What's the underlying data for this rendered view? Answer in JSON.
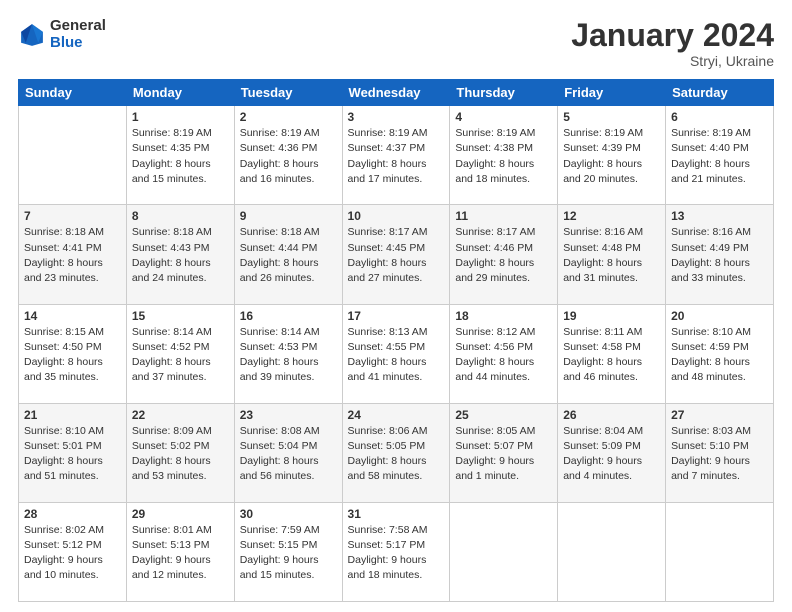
{
  "header": {
    "logo_line1": "General",
    "logo_line2": "Blue",
    "month_title": "January 2024",
    "location": "Stryi, Ukraine"
  },
  "weekdays": [
    "Sunday",
    "Monday",
    "Tuesday",
    "Wednesday",
    "Thursday",
    "Friday",
    "Saturday"
  ],
  "weeks": [
    [
      {
        "day": "",
        "info": ""
      },
      {
        "day": "1",
        "info": "Sunrise: 8:19 AM\nSunset: 4:35 PM\nDaylight: 8 hours\nand 15 minutes."
      },
      {
        "day": "2",
        "info": "Sunrise: 8:19 AM\nSunset: 4:36 PM\nDaylight: 8 hours\nand 16 minutes."
      },
      {
        "day": "3",
        "info": "Sunrise: 8:19 AM\nSunset: 4:37 PM\nDaylight: 8 hours\nand 17 minutes."
      },
      {
        "day": "4",
        "info": "Sunrise: 8:19 AM\nSunset: 4:38 PM\nDaylight: 8 hours\nand 18 minutes."
      },
      {
        "day": "5",
        "info": "Sunrise: 8:19 AM\nSunset: 4:39 PM\nDaylight: 8 hours\nand 20 minutes."
      },
      {
        "day": "6",
        "info": "Sunrise: 8:19 AM\nSunset: 4:40 PM\nDaylight: 8 hours\nand 21 minutes."
      }
    ],
    [
      {
        "day": "7",
        "info": "Sunrise: 8:18 AM\nSunset: 4:41 PM\nDaylight: 8 hours\nand 23 minutes."
      },
      {
        "day": "8",
        "info": "Sunrise: 8:18 AM\nSunset: 4:43 PM\nDaylight: 8 hours\nand 24 minutes."
      },
      {
        "day": "9",
        "info": "Sunrise: 8:18 AM\nSunset: 4:44 PM\nDaylight: 8 hours\nand 26 minutes."
      },
      {
        "day": "10",
        "info": "Sunrise: 8:17 AM\nSunset: 4:45 PM\nDaylight: 8 hours\nand 27 minutes."
      },
      {
        "day": "11",
        "info": "Sunrise: 8:17 AM\nSunset: 4:46 PM\nDaylight: 8 hours\nand 29 minutes."
      },
      {
        "day": "12",
        "info": "Sunrise: 8:16 AM\nSunset: 4:48 PM\nDaylight: 8 hours\nand 31 minutes."
      },
      {
        "day": "13",
        "info": "Sunrise: 8:16 AM\nSunset: 4:49 PM\nDaylight: 8 hours\nand 33 minutes."
      }
    ],
    [
      {
        "day": "14",
        "info": "Sunrise: 8:15 AM\nSunset: 4:50 PM\nDaylight: 8 hours\nand 35 minutes."
      },
      {
        "day": "15",
        "info": "Sunrise: 8:14 AM\nSunset: 4:52 PM\nDaylight: 8 hours\nand 37 minutes."
      },
      {
        "day": "16",
        "info": "Sunrise: 8:14 AM\nSunset: 4:53 PM\nDaylight: 8 hours\nand 39 minutes."
      },
      {
        "day": "17",
        "info": "Sunrise: 8:13 AM\nSunset: 4:55 PM\nDaylight: 8 hours\nand 41 minutes."
      },
      {
        "day": "18",
        "info": "Sunrise: 8:12 AM\nSunset: 4:56 PM\nDaylight: 8 hours\nand 44 minutes."
      },
      {
        "day": "19",
        "info": "Sunrise: 8:11 AM\nSunset: 4:58 PM\nDaylight: 8 hours\nand 46 minutes."
      },
      {
        "day": "20",
        "info": "Sunrise: 8:10 AM\nSunset: 4:59 PM\nDaylight: 8 hours\nand 48 minutes."
      }
    ],
    [
      {
        "day": "21",
        "info": "Sunrise: 8:10 AM\nSunset: 5:01 PM\nDaylight: 8 hours\nand 51 minutes."
      },
      {
        "day": "22",
        "info": "Sunrise: 8:09 AM\nSunset: 5:02 PM\nDaylight: 8 hours\nand 53 minutes."
      },
      {
        "day": "23",
        "info": "Sunrise: 8:08 AM\nSunset: 5:04 PM\nDaylight: 8 hours\nand 56 minutes."
      },
      {
        "day": "24",
        "info": "Sunrise: 8:06 AM\nSunset: 5:05 PM\nDaylight: 8 hours\nand 58 minutes."
      },
      {
        "day": "25",
        "info": "Sunrise: 8:05 AM\nSunset: 5:07 PM\nDaylight: 9 hours\nand 1 minute."
      },
      {
        "day": "26",
        "info": "Sunrise: 8:04 AM\nSunset: 5:09 PM\nDaylight: 9 hours\nand 4 minutes."
      },
      {
        "day": "27",
        "info": "Sunrise: 8:03 AM\nSunset: 5:10 PM\nDaylight: 9 hours\nand 7 minutes."
      }
    ],
    [
      {
        "day": "28",
        "info": "Sunrise: 8:02 AM\nSunset: 5:12 PM\nDaylight: 9 hours\nand 10 minutes."
      },
      {
        "day": "29",
        "info": "Sunrise: 8:01 AM\nSunset: 5:13 PM\nDaylight: 9 hours\nand 12 minutes."
      },
      {
        "day": "30",
        "info": "Sunrise: 7:59 AM\nSunset: 5:15 PM\nDaylight: 9 hours\nand 15 minutes."
      },
      {
        "day": "31",
        "info": "Sunrise: 7:58 AM\nSunset: 5:17 PM\nDaylight: 9 hours\nand 18 minutes."
      },
      {
        "day": "",
        "info": ""
      },
      {
        "day": "",
        "info": ""
      },
      {
        "day": "",
        "info": ""
      }
    ]
  ]
}
